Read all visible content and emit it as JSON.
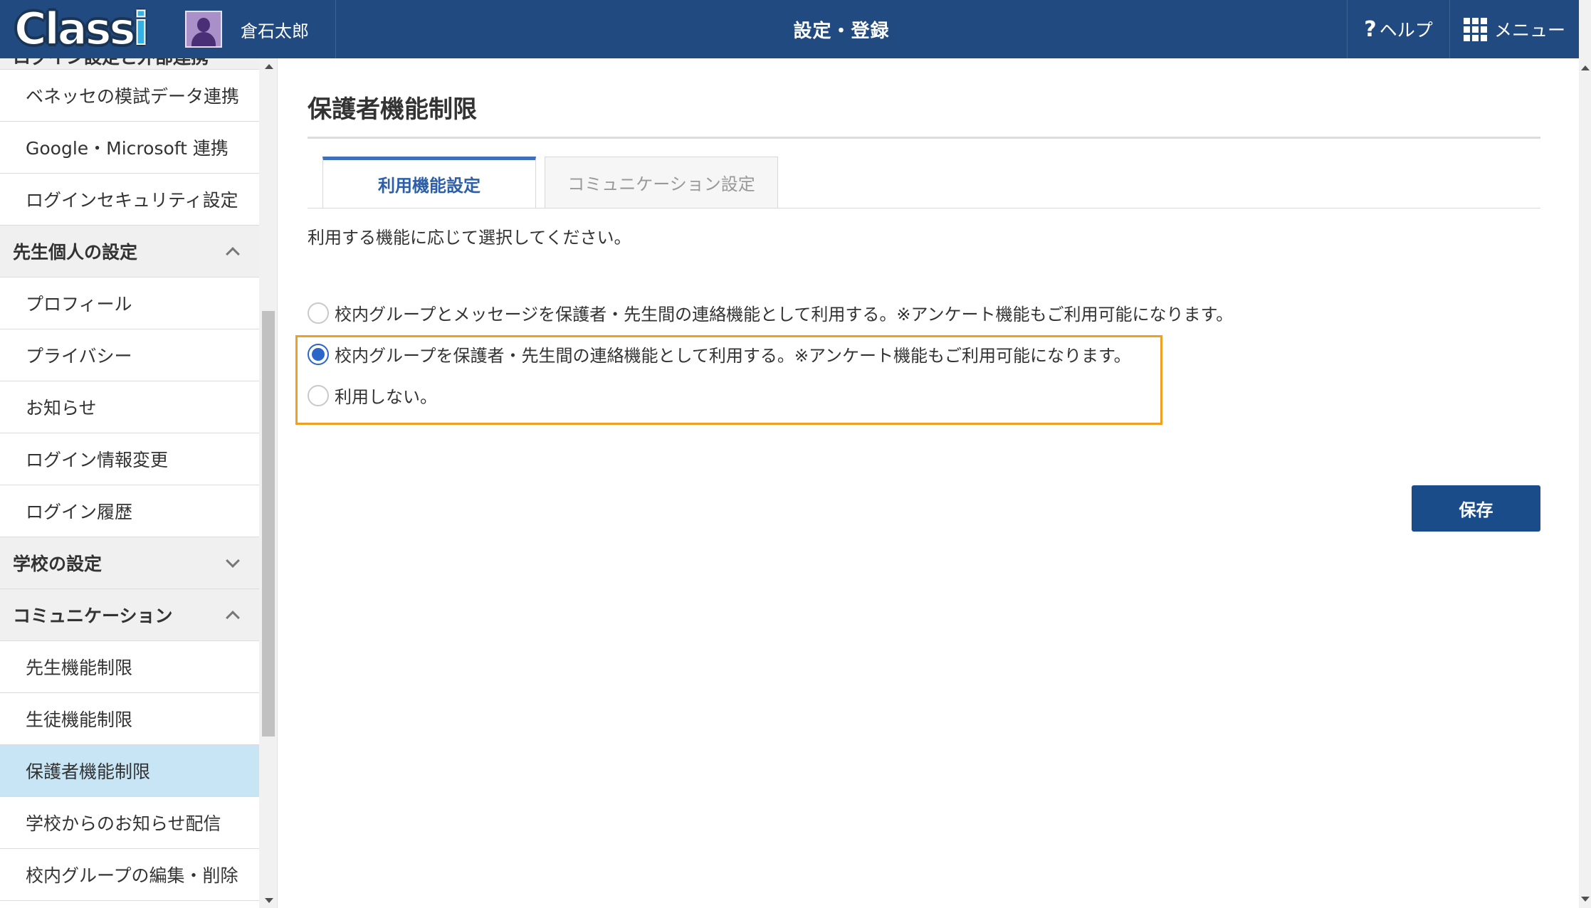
{
  "header": {
    "logo": "Classi",
    "user_name": "倉石太郎",
    "title": "設定・登録",
    "help_label": "ヘルプ",
    "menu_label": "メニュー"
  },
  "sidebar": {
    "partial_item": "ログイン設定と外部連携",
    "items_top": [
      {
        "label": "ベネッセの模試データ連携"
      },
      {
        "label": "Google・Microsoft 連携"
      },
      {
        "label": "ログインセキュリティ設定"
      }
    ],
    "section_personal": "先生個人の設定",
    "items_personal": [
      {
        "label": "プロフィール"
      },
      {
        "label": "プライバシー"
      },
      {
        "label": "お知らせ"
      },
      {
        "label": "ログイン情報変更"
      },
      {
        "label": "ログイン履歴"
      }
    ],
    "section_school": "学校の設定",
    "section_communication": "コミュニケーション",
    "items_communication": [
      {
        "label": "先生機能制限"
      },
      {
        "label": "生徒機能制限"
      },
      {
        "label": "保護者機能制限",
        "active": true
      },
      {
        "label": "学校からのお知らせ配信"
      },
      {
        "label": "校内グループの編集・削除"
      }
    ]
  },
  "main": {
    "page_title": "保護者機能制限",
    "tabs": [
      {
        "label": "利用機能設定",
        "active": true
      },
      {
        "label": "コミュニケーション設定",
        "active": false
      }
    ],
    "description": "利用する機能に応じて選択してください。",
    "options": [
      {
        "label": "校内グループとメッセージを保護者・先生間の連絡機能として利用する。※アンケート機能もご利用可能になります。",
        "checked": false
      },
      {
        "label": "校内グループを保護者・先生間の連絡機能として利用する。※アンケート機能もご利用可能になります。",
        "checked": true
      },
      {
        "label": "利用しない。",
        "checked": false
      }
    ],
    "save_label": "保存"
  },
  "colors": {
    "header_bg": "#204a80",
    "active_tab": "#3e6fb7",
    "highlight_border": "#f0a020",
    "save_button": "#1b4c8a",
    "active_sidebar": "#c7e5f4"
  }
}
